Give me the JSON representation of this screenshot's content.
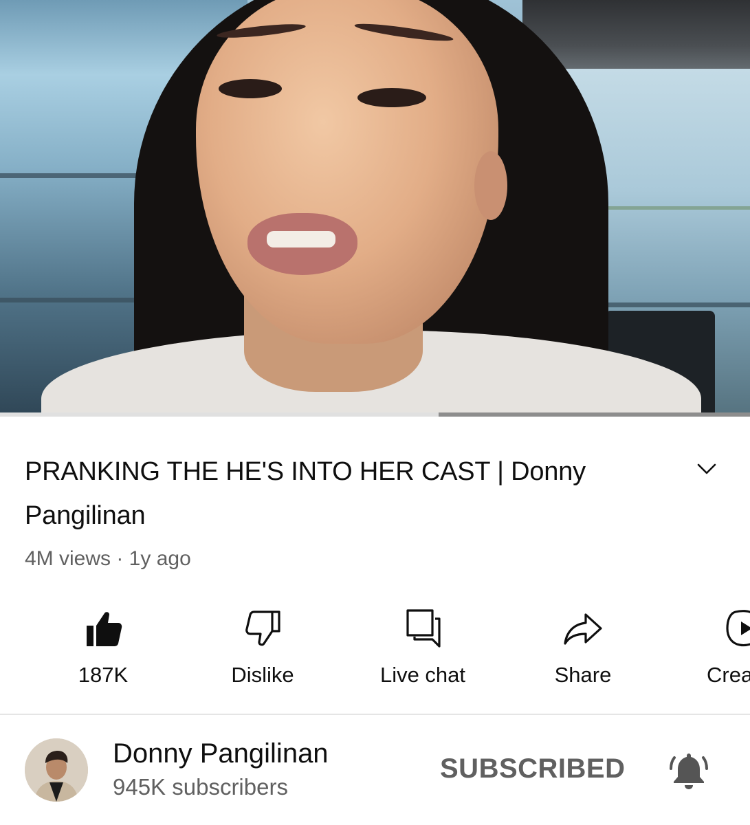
{
  "video": {
    "progress_fraction": 0.585
  },
  "title_block": {
    "title": "PRANKING THE HE'S INTO HER CAST | Donny Pangilinan",
    "meta": "4M views · 1y ago"
  },
  "actions": [
    {
      "label": "187K",
      "icon": "thumbs-up-filled-icon"
    },
    {
      "label": "Dislike",
      "icon": "thumbs-down-icon"
    },
    {
      "label": "Live chat",
      "icon": "live-chat-icon"
    },
    {
      "label": "Share",
      "icon": "share-icon"
    },
    {
      "label": "Crea",
      "icon": "create-icon"
    }
  ],
  "channel": {
    "name": "Donny Pangilinan",
    "subscribers": "945K subscribers",
    "subscribe_state": "SUBSCRIBED",
    "bell_icon": "bell-icon"
  }
}
